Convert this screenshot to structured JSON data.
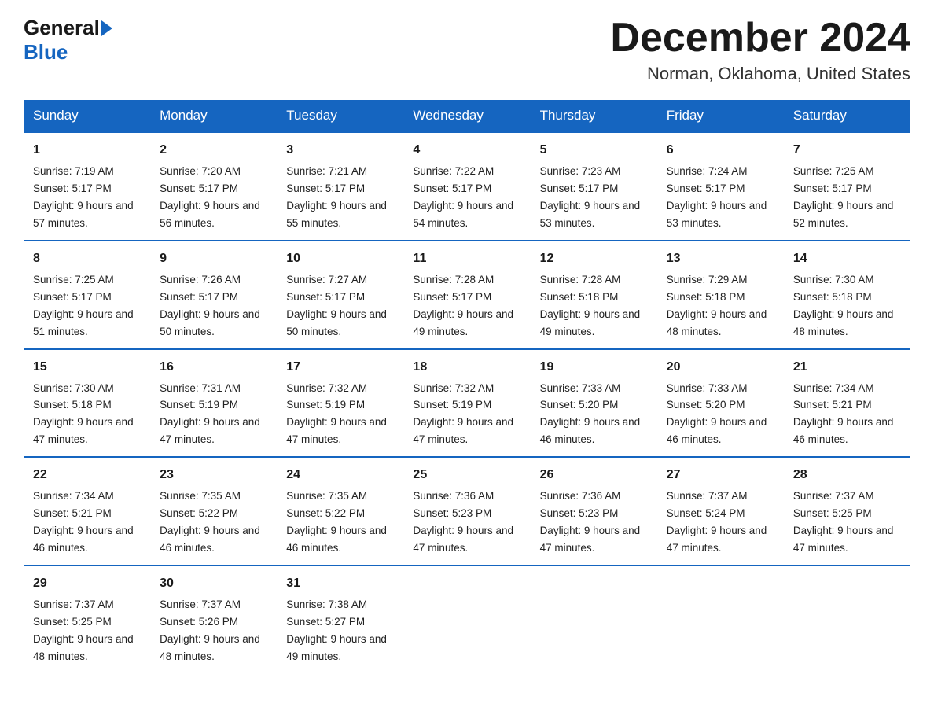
{
  "header": {
    "logo_general": "General",
    "logo_blue": "Blue",
    "title": "December 2024",
    "subtitle": "Norman, Oklahoma, United States"
  },
  "days_of_week": [
    "Sunday",
    "Monday",
    "Tuesday",
    "Wednesday",
    "Thursday",
    "Friday",
    "Saturday"
  ],
  "weeks": [
    [
      {
        "day": "1",
        "sunrise": "7:19 AM",
        "sunset": "5:17 PM",
        "daylight": "9 hours and 57 minutes."
      },
      {
        "day": "2",
        "sunrise": "7:20 AM",
        "sunset": "5:17 PM",
        "daylight": "9 hours and 56 minutes."
      },
      {
        "day": "3",
        "sunrise": "7:21 AM",
        "sunset": "5:17 PM",
        "daylight": "9 hours and 55 minutes."
      },
      {
        "day": "4",
        "sunrise": "7:22 AM",
        "sunset": "5:17 PM",
        "daylight": "9 hours and 54 minutes."
      },
      {
        "day": "5",
        "sunrise": "7:23 AM",
        "sunset": "5:17 PM",
        "daylight": "9 hours and 53 minutes."
      },
      {
        "day": "6",
        "sunrise": "7:24 AM",
        "sunset": "5:17 PM",
        "daylight": "9 hours and 53 minutes."
      },
      {
        "day": "7",
        "sunrise": "7:25 AM",
        "sunset": "5:17 PM",
        "daylight": "9 hours and 52 minutes."
      }
    ],
    [
      {
        "day": "8",
        "sunrise": "7:25 AM",
        "sunset": "5:17 PM",
        "daylight": "9 hours and 51 minutes."
      },
      {
        "day": "9",
        "sunrise": "7:26 AM",
        "sunset": "5:17 PM",
        "daylight": "9 hours and 50 minutes."
      },
      {
        "day": "10",
        "sunrise": "7:27 AM",
        "sunset": "5:17 PM",
        "daylight": "9 hours and 50 minutes."
      },
      {
        "day": "11",
        "sunrise": "7:28 AM",
        "sunset": "5:17 PM",
        "daylight": "9 hours and 49 minutes."
      },
      {
        "day": "12",
        "sunrise": "7:28 AM",
        "sunset": "5:18 PM",
        "daylight": "9 hours and 49 minutes."
      },
      {
        "day": "13",
        "sunrise": "7:29 AM",
        "sunset": "5:18 PM",
        "daylight": "9 hours and 48 minutes."
      },
      {
        "day": "14",
        "sunrise": "7:30 AM",
        "sunset": "5:18 PM",
        "daylight": "9 hours and 48 minutes."
      }
    ],
    [
      {
        "day": "15",
        "sunrise": "7:30 AM",
        "sunset": "5:18 PM",
        "daylight": "9 hours and 47 minutes."
      },
      {
        "day": "16",
        "sunrise": "7:31 AM",
        "sunset": "5:19 PM",
        "daylight": "9 hours and 47 minutes."
      },
      {
        "day": "17",
        "sunrise": "7:32 AM",
        "sunset": "5:19 PM",
        "daylight": "9 hours and 47 minutes."
      },
      {
        "day": "18",
        "sunrise": "7:32 AM",
        "sunset": "5:19 PM",
        "daylight": "9 hours and 47 minutes."
      },
      {
        "day": "19",
        "sunrise": "7:33 AM",
        "sunset": "5:20 PM",
        "daylight": "9 hours and 46 minutes."
      },
      {
        "day": "20",
        "sunrise": "7:33 AM",
        "sunset": "5:20 PM",
        "daylight": "9 hours and 46 minutes."
      },
      {
        "day": "21",
        "sunrise": "7:34 AM",
        "sunset": "5:21 PM",
        "daylight": "9 hours and 46 minutes."
      }
    ],
    [
      {
        "day": "22",
        "sunrise": "7:34 AM",
        "sunset": "5:21 PM",
        "daylight": "9 hours and 46 minutes."
      },
      {
        "day": "23",
        "sunrise": "7:35 AM",
        "sunset": "5:22 PM",
        "daylight": "9 hours and 46 minutes."
      },
      {
        "day": "24",
        "sunrise": "7:35 AM",
        "sunset": "5:22 PM",
        "daylight": "9 hours and 46 minutes."
      },
      {
        "day": "25",
        "sunrise": "7:36 AM",
        "sunset": "5:23 PM",
        "daylight": "9 hours and 47 minutes."
      },
      {
        "day": "26",
        "sunrise": "7:36 AM",
        "sunset": "5:23 PM",
        "daylight": "9 hours and 47 minutes."
      },
      {
        "day": "27",
        "sunrise": "7:37 AM",
        "sunset": "5:24 PM",
        "daylight": "9 hours and 47 minutes."
      },
      {
        "day": "28",
        "sunrise": "7:37 AM",
        "sunset": "5:25 PM",
        "daylight": "9 hours and 47 minutes."
      }
    ],
    [
      {
        "day": "29",
        "sunrise": "7:37 AM",
        "sunset": "5:25 PM",
        "daylight": "9 hours and 48 minutes."
      },
      {
        "day": "30",
        "sunrise": "7:37 AM",
        "sunset": "5:26 PM",
        "daylight": "9 hours and 48 minutes."
      },
      {
        "day": "31",
        "sunrise": "7:38 AM",
        "sunset": "5:27 PM",
        "daylight": "9 hours and 49 minutes."
      },
      null,
      null,
      null,
      null
    ]
  ]
}
